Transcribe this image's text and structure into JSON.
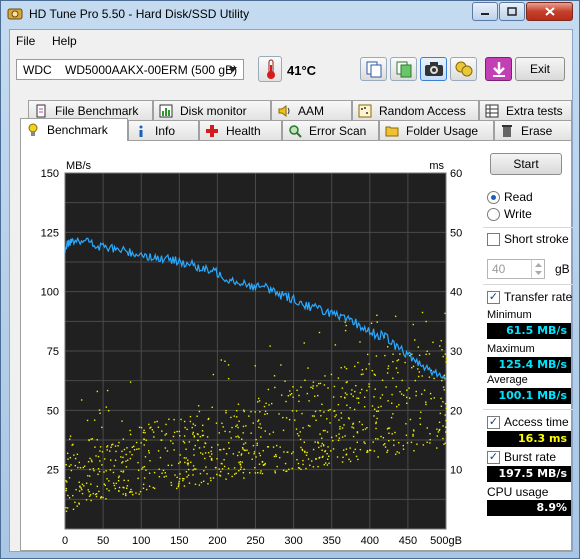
{
  "window": {
    "title": "HD Tune Pro 5.50 - Hard Disk/SSD Utility"
  },
  "menu": {
    "file": "File",
    "help": "Help"
  },
  "toolbar": {
    "drive": "WDC    WD5000AAKX-00ERM (500 gB)",
    "temperature": "41°C",
    "exit_label": "Exit"
  },
  "tabs_row1": [
    {
      "label": "File Benchmark",
      "icon": "file-benchmark-icon"
    },
    {
      "label": "Disk monitor",
      "icon": "disk-monitor-icon"
    },
    {
      "label": "AAM",
      "icon": "speaker-icon"
    },
    {
      "label": "Random Access",
      "icon": "random-access-icon"
    },
    {
      "label": "Extra tests",
      "icon": "extra-tests-icon"
    }
  ],
  "tabs_row2": [
    {
      "label": "Benchmark",
      "icon": "benchmark-icon",
      "active": true
    },
    {
      "label": "Info",
      "icon": "info-icon"
    },
    {
      "label": "Health",
      "icon": "health-icon"
    },
    {
      "label": "Error Scan",
      "icon": "error-scan-icon"
    },
    {
      "label": "Folder Usage",
      "icon": "folder-icon"
    },
    {
      "label": "Erase",
      "icon": "erase-icon"
    }
  ],
  "controls": {
    "start_label": "Start",
    "read_label": "Read",
    "write_label": "Write",
    "mode_selected": "read",
    "short_stroke_label": "Short stroke",
    "short_stroke_checked": false,
    "short_stroke_value": "40",
    "short_stroke_unit": "gB",
    "transfer_rate_label": "Transfer rate",
    "transfer_rate_checked": true,
    "access_time_label": "Access time",
    "access_time_checked": true,
    "burst_rate_label": "Burst rate",
    "burst_rate_checked": true
  },
  "stats": {
    "minimum_label": "Minimum",
    "minimum": "61.5 MB/s",
    "maximum_label": "Maximum",
    "maximum": "125.4 MB/s",
    "average_label": "Average",
    "average": "100.1 MB/s",
    "access_time": "16.3 ms",
    "burst_rate": "197.5 MB/s",
    "cpu_label": "CPU usage",
    "cpu_usage": "8.9%"
  },
  "colors": {
    "chart_bg": "#202020",
    "grid": "#4a4a4a",
    "transfer_line": "#2aa9ff",
    "access_points": "#f0f000"
  },
  "chart_data": {
    "type": "line",
    "ylabel_left": "MB/s",
    "ylabel_right": "ms",
    "x_unit_label": "500gB",
    "xlim": [
      0,
      500
    ],
    "ylim_left": [
      0,
      150
    ],
    "ylim_right": [
      0,
      60
    ],
    "x_ticks": [
      0,
      50,
      100,
      150,
      200,
      250,
      300,
      350,
      400,
      450
    ],
    "y_ticks_left": [
      25,
      50,
      75,
      100,
      125,
      150
    ],
    "y_ticks_right": [
      10,
      20,
      30,
      40,
      50,
      60
    ],
    "grid": true,
    "series": [
      {
        "kind": "transfer_rate",
        "axis": "left",
        "x": [
          0,
          5,
          10,
          20,
          30,
          40,
          50,
          60,
          70,
          80,
          90,
          100,
          110,
          120,
          130,
          140,
          150,
          160,
          170,
          180,
          190,
          200,
          210,
          220,
          230,
          240,
          250,
          260,
          270,
          280,
          290,
          300,
          310,
          320,
          330,
          340,
          350,
          360,
          370,
          380,
          390,
          400,
          410,
          420,
          430,
          440,
          450,
          460,
          470,
          480,
          490,
          500
        ],
        "y": [
          117,
          121,
          122,
          122,
          121,
          119,
          119,
          118,
          118,
          117,
          116,
          116,
          115,
          114,
          114,
          113,
          113,
          112,
          111,
          109,
          109,
          108,
          106,
          105,
          104,
          103,
          102,
          102,
          101,
          99,
          98,
          97,
          95,
          94,
          93,
          92,
          91,
          89,
          88,
          87,
          85,
          83,
          82,
          81,
          78,
          76,
          73,
          71,
          69,
          67,
          65,
          63
        ]
      },
      {
        "kind": "access_time",
        "axis": "right",
        "spread_low": [
          3,
          5,
          6,
          7,
          8,
          9,
          10,
          11,
          12,
          13,
          14
        ],
        "spread_high": [
          14,
          16,
          18,
          19,
          21,
          23,
          25,
          27,
          29,
          31,
          33
        ],
        "x_bins": [
          0,
          50,
          100,
          150,
          200,
          250,
          300,
          350,
          400,
          450,
          500
        ]
      }
    ]
  }
}
